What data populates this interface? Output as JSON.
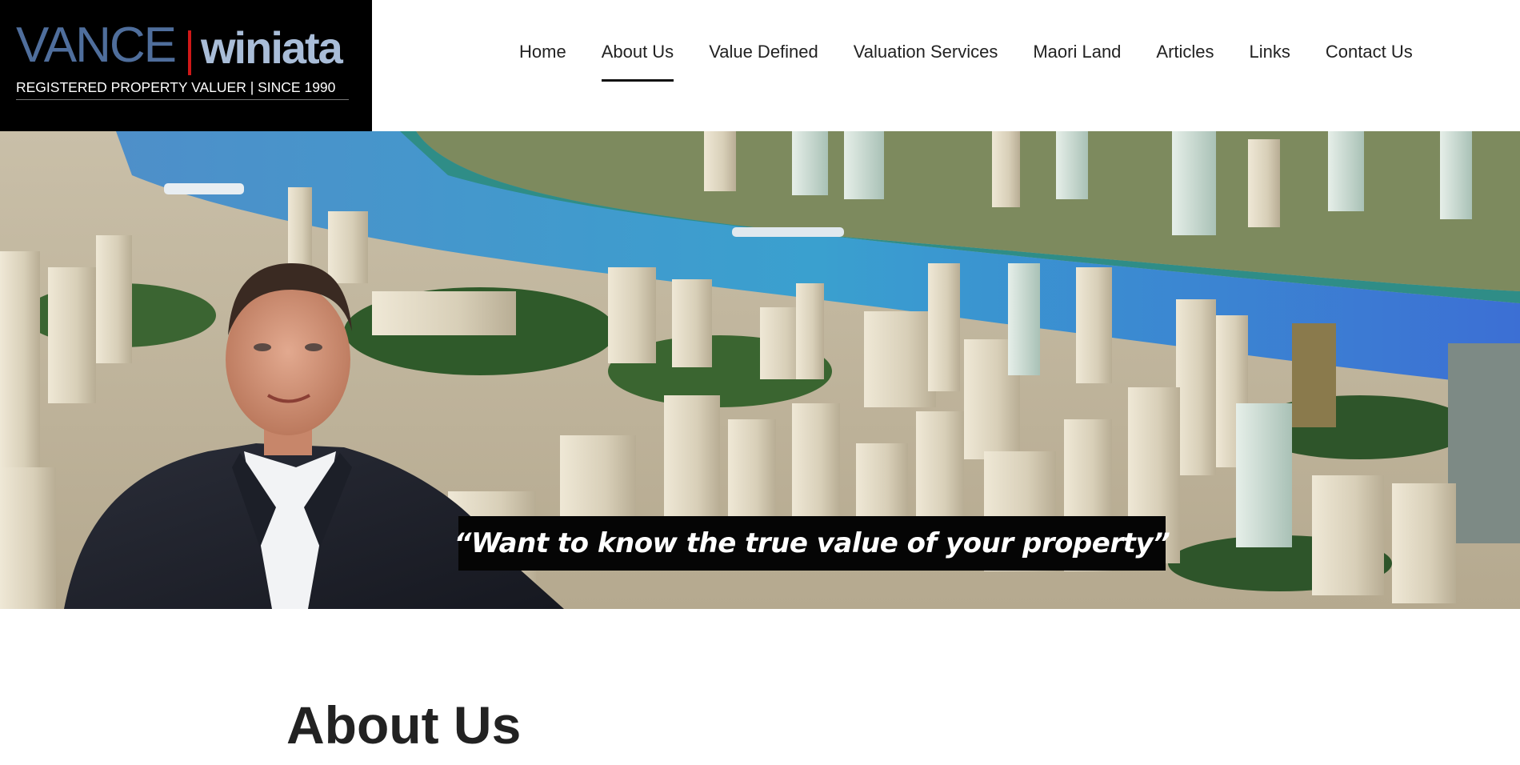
{
  "logo": {
    "brand_primary": "VANCE",
    "brand_secondary": "winiata",
    "tagline": "REGISTERED PROPERTY VALUER | SINCE 1990",
    "colors": {
      "primary": "#4f6e9c",
      "secondary": "#a9bdd8",
      "divider": "#d01818",
      "background": "#000000"
    }
  },
  "nav": {
    "items": [
      {
        "label": "Home",
        "active": false
      },
      {
        "label": "About Us",
        "active": true
      },
      {
        "label": "Value Defined",
        "active": false
      },
      {
        "label": "Valuation Services",
        "active": false
      },
      {
        "label": "Maori Land",
        "active": false
      },
      {
        "label": "Articles",
        "active": false
      },
      {
        "label": "Links",
        "active": false
      },
      {
        "label": "Contact Us",
        "active": false
      }
    ]
  },
  "hero": {
    "quote": "“Want to know the true value of your property”",
    "image_subject": "city-model-with-river-and-man-in-suit"
  },
  "main": {
    "title": "About Us"
  }
}
